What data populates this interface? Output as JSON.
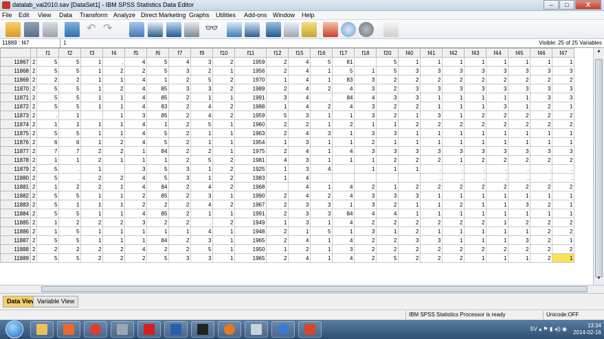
{
  "window": {
    "title": "datalab_val2010.sav [DataSet1] - IBM SPSS Statistics Data Editor",
    "controls": [
      "–",
      "□",
      "X"
    ]
  },
  "menu": [
    "File",
    "Edit",
    "View",
    "Data",
    "Transform",
    "Analyze",
    "Direct Marketing",
    "Graphs",
    "Utilities",
    "Add-ons",
    "Window",
    "Help"
  ],
  "cell_editor": {
    "reference": "11889 : f47",
    "value": "1",
    "visible_vars": "Visible: 25 of 25 Variables"
  },
  "grid": {
    "columns": [
      "f1",
      "f2",
      "f3",
      "f4",
      "f5",
      "f6",
      "f7",
      "f9",
      "f10",
      "f11",
      "f12",
      "f15",
      "f16",
      "f17",
      "f18",
      "f20",
      "f40",
      "f41",
      "f42",
      "f43",
      "f44",
      "f45",
      "f46",
      "f47"
    ],
    "rows": [
      {
        "id": "11867",
        "lead": "2",
        "cells": [
          "5",
          "5",
          "1",
          ".",
          "4",
          "5",
          "4",
          "3",
          "2",
          "1959",
          "2",
          "4",
          "5",
          "81",
          "",
          "5",
          "1",
          "1",
          "1",
          "1",
          "1",
          "1",
          "1",
          "1"
        ]
      },
      {
        "id": "11868",
        "lead": "2",
        "cells": [
          "5",
          "5",
          "1",
          "2",
          "2",
          "5",
          "3",
          "2",
          "1",
          "1956",
          "2",
          "4",
          "1",
          "5",
          "1",
          "5",
          "3",
          "3",
          "3",
          "3",
          "3",
          "3",
          "3",
          "3"
        ]
      },
      {
        "id": "11869",
        "lead": "2",
        "cells": [
          "2",
          "2",
          "1",
          "1",
          "4",
          "1",
          "2",
          "5",
          "2",
          "1970",
          "1",
          "4",
          "1",
          "83",
          "3",
          "2",
          "2",
          "2",
          "2",
          "2",
          "2",
          "2",
          "2",
          "2"
        ]
      },
      {
        "id": "11870",
        "lead": "2",
        "cells": [
          "5",
          "5",
          "1",
          "2",
          "4",
          "85",
          "3",
          "3",
          "2",
          "1989",
          "2",
          "4",
          "2",
          "4",
          "3",
          "2",
          "3",
          "3",
          "3",
          "3",
          "3",
          "3",
          "3",
          "3"
        ]
      },
      {
        "id": "11871",
        "lead": "2",
        "cells": [
          "5",
          "5",
          "1",
          "1",
          "4",
          "85",
          "2",
          "1",
          "1",
          "1991",
          "3",
          "4",
          ".",
          "84",
          "4",
          "3",
          "3",
          "1",
          "1",
          "1",
          "1",
          "1",
          "3",
          "3"
        ]
      },
      {
        "id": "11872",
        "lead": "2",
        "cells": [
          "5",
          "5",
          "1",
          "1",
          "4",
          "83",
          "2",
          "4",
          "2",
          "1988",
          "1",
          "4",
          "2",
          "4",
          "3",
          "2",
          "2",
          "1",
          "1",
          "1",
          "3",
          "1",
          "2",
          "1"
        ]
      },
      {
        "id": "11873",
        "lead": "2",
        "cells": [
          ".",
          "1",
          "",
          "1",
          "3",
          "85",
          "2",
          "4",
          "2",
          "1959",
          "5",
          "3",
          "1",
          "1",
          "3",
          "2",
          "1",
          "3",
          "1",
          "2",
          "2",
          "2",
          "2",
          "2"
        ]
      },
      {
        "id": "11874",
        "lead": "2",
        "cells": [
          "1",
          "1",
          "1",
          "1",
          "4",
          "1",
          "2",
          "5",
          "1",
          "1960",
          "2",
          "2",
          "1",
          "2",
          "1",
          "1",
          "2",
          "2",
          "2",
          "2",
          "2",
          "2",
          "2",
          "2"
        ]
      },
      {
        "id": "11875",
        "lead": "2",
        "cells": [
          "5",
          "5",
          "1",
          "1",
          "4",
          "5",
          "2",
          "1",
          "1",
          "1963",
          "2",
          "4",
          "3",
          "1",
          "3",
          "3",
          "1",
          "1",
          "1",
          "1",
          "1",
          "1",
          "1",
          "1"
        ]
      },
      {
        "id": "11876",
        "lead": "2",
        "cells": [
          "6",
          "6",
          "1",
          "2",
          "4",
          "5",
          "2",
          "1",
          "1",
          "1954",
          "1",
          "3",
          "1",
          "1",
          "2",
          "1",
          "1",
          "1",
          "1",
          "1",
          "1",
          "1",
          "1",
          "1"
        ]
      },
      {
        "id": "11877",
        "lead": "2",
        "cells": [
          "7",
          "7",
          "2",
          "2",
          "1",
          "84",
          "2",
          "2",
          "1",
          "1975",
          "2",
          "4",
          "1",
          "4",
          "3",
          "3",
          "3",
          "3",
          "3",
          "3",
          "3",
          "3",
          "3",
          "3"
        ]
      },
      {
        "id": "11878",
        "lead": "2",
        "cells": [
          "1",
          "1",
          "2",
          "1",
          "1",
          "1",
          "2",
          "5",
          "2",
          "1981",
          "4",
          "3",
          "1",
          "1",
          "1",
          "2",
          "2",
          "2",
          "1",
          "2",
          "2",
          "2",
          "2",
          "2"
        ]
      },
      {
        "id": "11879",
        "lead": "2",
        "cells": [
          "5",
          ".",
          "1",
          "",
          "3",
          "5",
          "3",
          "1",
          "2",
          "1925",
          "1",
          "3",
          "4",
          "",
          "1",
          "1",
          "1",
          ".",
          ".",
          ".",
          ".",
          ".",
          ".",
          "."
        ]
      },
      {
        "id": "11880",
        "lead": "2",
        "cells": [
          "5",
          ".",
          "2",
          "2",
          "4",
          "5",
          "3",
          "1",
          "2",
          "1983",
          "1",
          "4",
          "",
          "",
          "",
          "",
          "",
          ".",
          ".",
          ".",
          ".",
          ".",
          ".",
          "."
        ]
      },
      {
        "id": "11881",
        "lead": "2",
        "cells": [
          "1",
          "2",
          "2",
          "1",
          "4",
          "84",
          "2",
          "4",
          "2",
          "1968",
          "",
          "4",
          "1",
          "4",
          "2",
          "1",
          "2",
          "2",
          "2",
          "2",
          "2",
          "2",
          "2",
          "2"
        ]
      },
      {
        "id": "11882",
        "lead": "2",
        "cells": [
          "5",
          "5",
          "1",
          "1",
          "2",
          "85",
          "2",
          "3",
          "1",
          "1990",
          "2",
          "4",
          "2",
          "4",
          "3",
          "3",
          "3",
          "1",
          "1",
          "1",
          "1",
          "1",
          "1",
          "1"
        ]
      },
      {
        "id": "11883",
        "lead": "2",
        "cells": [
          "5",
          "1",
          "1",
          "1",
          "2",
          "2",
          "2",
          "4",
          "2",
          "1967",
          "2",
          "3",
          "3",
          "1",
          "3",
          "2",
          "1",
          "1",
          "2",
          "1",
          "1",
          "3",
          "2",
          "1"
        ]
      },
      {
        "id": "11884",
        "lead": "2",
        "cells": [
          "5",
          "5",
          "1",
          "1",
          "4",
          "85",
          "2",
          "1",
          "1",
          "1991",
          "2",
          "3",
          "3",
          "84",
          "4",
          "4",
          "1",
          "1",
          "1",
          "1",
          "1",
          "1",
          "1",
          "1"
        ]
      },
      {
        "id": "11885",
        "lead": "2",
        "cells": [
          "1",
          "2",
          "2",
          "2",
          "3",
          "2",
          "2",
          ".",
          "2",
          "1949",
          "1",
          "3",
          "1",
          "4",
          "2",
          "2",
          "2",
          "2",
          "2",
          "2",
          "1",
          "2",
          "2",
          "2"
        ]
      },
      {
        "id": "11886",
        "lead": "2",
        "cells": [
          "1",
          "5",
          "1",
          "1",
          "1",
          "1",
          "1",
          "4",
          "1",
          "1948",
          "2",
          "1",
          "5",
          "1",
          "3",
          "1",
          "2",
          "1",
          "1",
          "1",
          "1",
          "1",
          "2",
          "2"
        ]
      },
      {
        "id": "11887",
        "lead": "2",
        "cells": [
          "5",
          "5",
          "1",
          "1",
          "1",
          "84",
          "2",
          "3",
          "1",
          "1965",
          "2",
          "4",
          "1",
          "4",
          "2",
          "2",
          "3",
          "3",
          "1",
          "1",
          "1",
          "3",
          "2",
          "1"
        ]
      },
      {
        "id": "11888",
        "lead": "2",
        "cells": [
          "2",
          "2",
          "2",
          "2",
          "4",
          "2",
          "2",
          "5",
          "1",
          "1950",
          "1",
          "2",
          "1",
          "3",
          "2",
          "2",
          "2",
          "2",
          "2",
          "2",
          "2",
          "2",
          "2",
          "2"
        ]
      },
      {
        "id": "11889",
        "lead": "2",
        "cells": [
          "5",
          "5",
          "2",
          "2",
          "2",
          "5",
          "3",
          "3",
          "1",
          "1965",
          "2",
          "4",
          "1",
          "4",
          "2",
          "5",
          "2",
          "2",
          "2",
          "1",
          "1",
          "1",
          "2",
          "1"
        ]
      }
    ]
  },
  "view_tabs": [
    "Data View",
    "Variable View"
  ],
  "status": {
    "processor": "IBM SPSS Statistics Processor is ready",
    "unicode": "Unicode:OFF"
  },
  "tray": {
    "time": "13:34",
    "date": "2014-02-16",
    "lang": "SV"
  }
}
